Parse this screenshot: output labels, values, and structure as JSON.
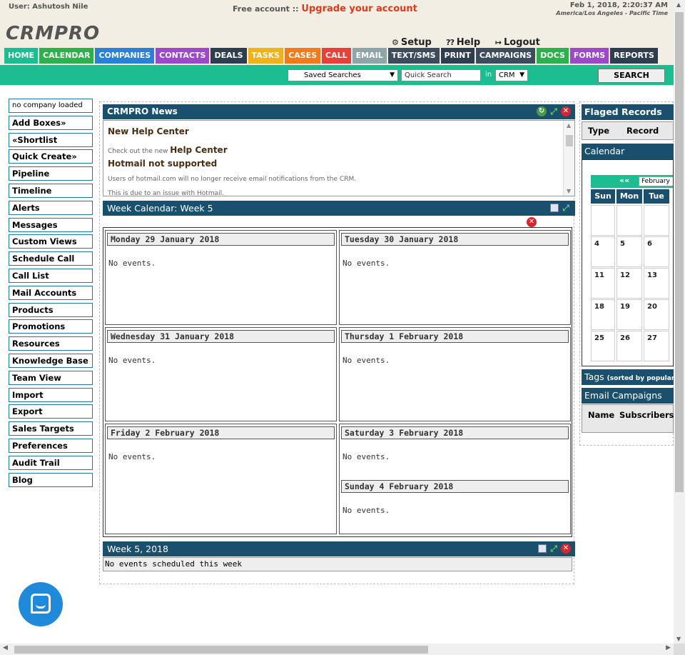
{
  "header": {
    "user": "User: Ashutosh Nile",
    "free_account": "Free account ::",
    "upgrade": "Upgrade your account",
    "datetime": "Feb 1, 2018, 2:20:37 AM",
    "timezone": "America/Los Angeles - Pacific Time",
    "logo": "CRMPRO",
    "setup": "Setup",
    "help": "Help",
    "logout": "Logout"
  },
  "nav": {
    "tabs": [
      {
        "label": "HOME",
        "color": "#1cbd91"
      },
      {
        "label": "CALENDAR",
        "color": "#2eb14c"
      },
      {
        "label": "COMPANIES",
        "color": "#2a7fd6"
      },
      {
        "label": "CONTACTS",
        "color": "#9b49c8"
      },
      {
        "label": "DEALS",
        "color": "#2f3e4e"
      },
      {
        "label": "TASKS",
        "color": "#f0b11c"
      },
      {
        "label": "CASES",
        "color": "#f07a1c"
      },
      {
        "label": "CALL",
        "color": "#e8413a"
      },
      {
        "label": "EMAIL",
        "color": "#8fa6a8"
      },
      {
        "label": "TEXT/SMS",
        "color": "#3d4c5c"
      },
      {
        "label": "PRINT",
        "color": "#2f3e4e"
      },
      {
        "label": "CAMPAIGNS",
        "color": "#3d4c5c"
      },
      {
        "label": "DOCS",
        "color": "#2eb14c"
      },
      {
        "label": "FORMS",
        "color": "#9b49c8"
      },
      {
        "label": "REPORTS",
        "color": "#2f3e4e"
      }
    ]
  },
  "search": {
    "saved_searches": "Saved Searches",
    "quick_search": "Quick Search",
    "in_label": "in",
    "scope": "CRM",
    "button": "SEARCH"
  },
  "sidebar": {
    "items": [
      "no company loaded",
      "Add Boxes»",
      "«Shortlist",
      "Quick Create»",
      "Pipeline",
      "Timeline",
      "Alerts",
      "Messages",
      "Custom Views",
      "Schedule Call",
      "Call List",
      "Mail Accounts",
      "Products",
      "Promotions",
      "Resources",
      "Knowledge Base",
      "Team View",
      "Import",
      "Export",
      "Sales Targets",
      "Preferences",
      "Audit Trail",
      "Blog"
    ]
  },
  "news": {
    "title": "CRMPRO News",
    "item1_title": "New Help Center",
    "item1_prefix": "Check out the new",
    "item1_link": "Help Center",
    "item2_title": "Hotmail not supported",
    "item2_line1": "Users of hotmail.com will no longer receive email notifications from the CRM.",
    "item2_line2": "This is due to an issue with Hotmail."
  },
  "week_calendar": {
    "title": "Week Calendar: Week 5",
    "days": [
      {
        "label": "Monday 29 January 2018",
        "events": "No events."
      },
      {
        "label": "Tuesday 30 January 2018",
        "events": "No events."
      },
      {
        "label": "Wednesday 31 January 2018",
        "events": "No events."
      },
      {
        "label": "Thursday 1 February 2018",
        "events": "No events."
      },
      {
        "label": "Friday 2 February 2018",
        "events": "No events."
      },
      {
        "label": "Saturday 3 February 2018",
        "events": "No events."
      },
      {
        "label": "Sunday 4 February 2018",
        "events": "No events."
      }
    ]
  },
  "week5": {
    "title": "Week 5, 2018",
    "message": "No events scheduled this week"
  },
  "right": {
    "flagged_title": "Flaged Records",
    "flag_col_type": "Type",
    "flag_col_record": "Record",
    "calendar_title": "Calendar",
    "cal_prev": "««",
    "cal_month": "February",
    "cal_days": [
      "Sun",
      "Mon",
      "Tue"
    ],
    "cal_rows": [
      [
        "",
        "",
        ""
      ],
      [
        "4",
        "5",
        "6"
      ],
      [
        "11",
        "12",
        "13"
      ],
      [
        "18",
        "19",
        "20"
      ],
      [
        "25",
        "26",
        "27"
      ]
    ],
    "tags_title": "Tags",
    "tags_note": "(sorted by popularity)",
    "email_title": "Email Campaigns",
    "email_col_name": "Name",
    "email_col_subscribers": "Subscribers"
  },
  "icons": {
    "setup": "gears-icon",
    "help": "help-icon",
    "logout": "logout-icon",
    "chat": "chat-icon"
  }
}
